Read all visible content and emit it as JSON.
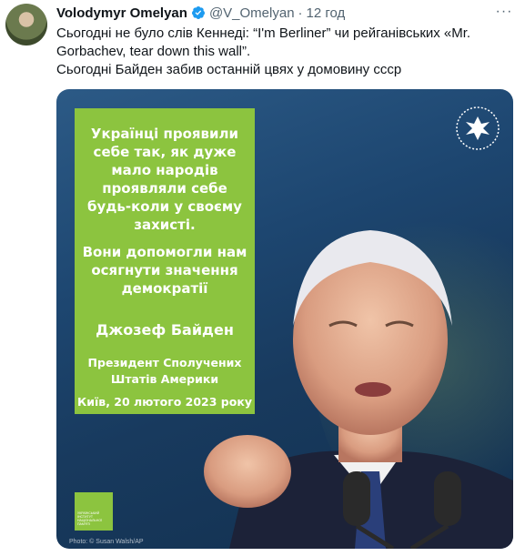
{
  "tweet": {
    "author_name": "Volodymyr Omelyan",
    "handle": "@V_Omelyan",
    "separator": "·",
    "time": "12 год",
    "more_label": "···",
    "text_line1": "Сьогодні не було слів Кеннеді: “I'm Berliner” чи рейганівських «Mr. Gorbachev, tear down this wall”.",
    "text_line2": "Сьогодні Байден забив останній цвях у домовину ссср"
  },
  "image": {
    "quote_part1": "Українці проявили себе так, як дуже мало народів проявляли себе будь-коли у своєму захисті.",
    "quote_part2": "Вони допомогли нам осягнути значення демократії",
    "author": "Джозеф Байден",
    "role": "Президент Сполучених Штатів Америки",
    "place_date": "Київ, 20 лютого 2023 року",
    "logo_text": "УКРАЇНСЬКИЙ ІНСТИТУТ НАЦІОНАЛЬНОЇ ПАМ'ЯТІ",
    "photo_credit": "Photo: © Susan Walsh/AP"
  },
  "colors": {
    "card_green": "#8cc43f",
    "verified_blue": "#1d9bf0",
    "muted": "#536471"
  },
  "icons": {
    "verified": "verified-badge-icon",
    "more": "more-icon",
    "seal": "presidential-seal-icon"
  }
}
